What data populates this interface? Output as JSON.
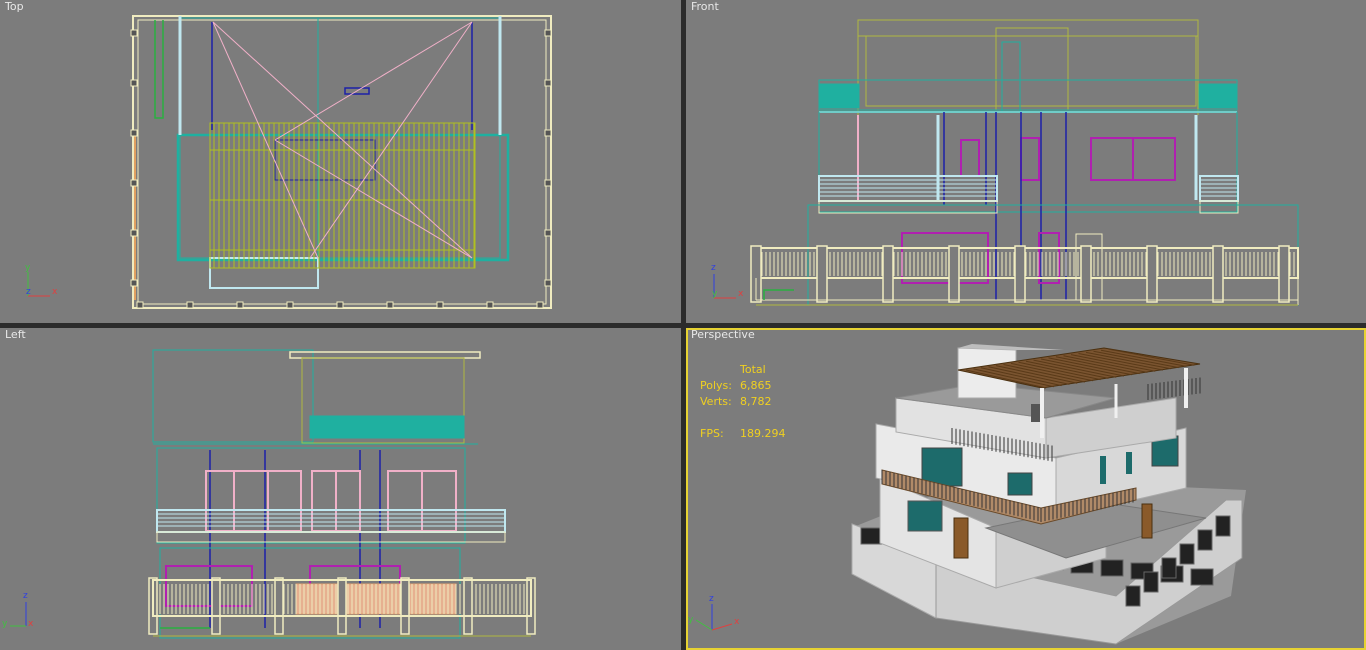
{
  "viewports": {
    "top": {
      "label": "Top"
    },
    "front": {
      "label": "Front"
    },
    "left": {
      "label": "Left"
    },
    "perspective": {
      "label": "Perspective"
    }
  },
  "stats": {
    "header": "Total",
    "polys_label": "Polys:",
    "polys_value": "6,865",
    "verts_label": "Verts:",
    "verts_value": "8,782",
    "fps_label": "FPS:",
    "fps_value": "189.294"
  },
  "axes": {
    "x": "x",
    "y": "y",
    "z": "z"
  },
  "colors": {
    "viewport_bg": "#7c7c7c",
    "active_border": "#e6d233",
    "stats_text": "#f0d020",
    "teal": "#1fb0a0",
    "cream": "#f0ecc0",
    "magenta": "#b020b0",
    "navy": "#1c20a8",
    "olive": "#b0b840",
    "pink": "#f0b0c8"
  }
}
